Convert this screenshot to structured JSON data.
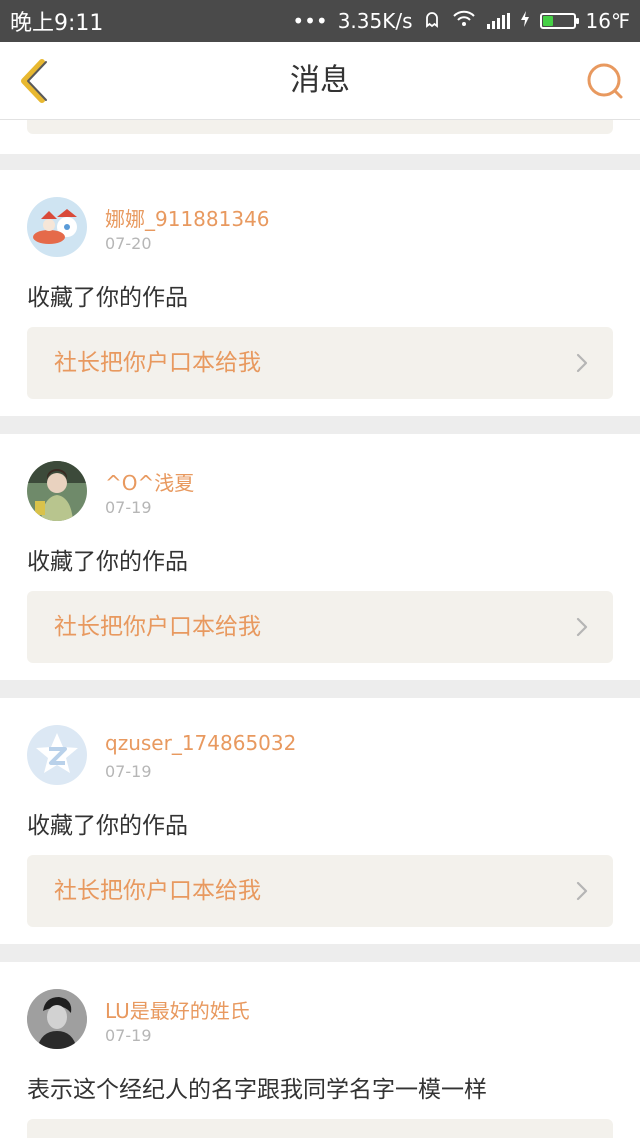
{
  "status_bar": {
    "time": "晚上9:11",
    "dots": "•••",
    "speed": "3.35K/s",
    "temperature": "16℉"
  },
  "header": {
    "title": "消息"
  },
  "messages": [
    {
      "username": "娜娜_911881346",
      "date": "07-20",
      "action": "收藏了你的作品",
      "work_title": "社长把你户口本给我"
    },
    {
      "username": "^O^浅夏",
      "date": "07-19",
      "action": "收藏了你的作品",
      "work_title": "社长把你户口本给我"
    },
    {
      "username": "qzuser_174865032",
      "date": "07-19",
      "action": "收藏了你的作品",
      "work_title": "社长把你户口本给我"
    },
    {
      "username": "LU是最好的姓氏",
      "date": "07-19",
      "action": "表示这个经纪人的名字跟我同学名字一模一样",
      "work_title": ""
    }
  ],
  "colors": {
    "accent": "#e8995f",
    "back_icon": "#e8b830",
    "quote_bg": "#f3f1ec",
    "page_bg": "#ededed"
  }
}
